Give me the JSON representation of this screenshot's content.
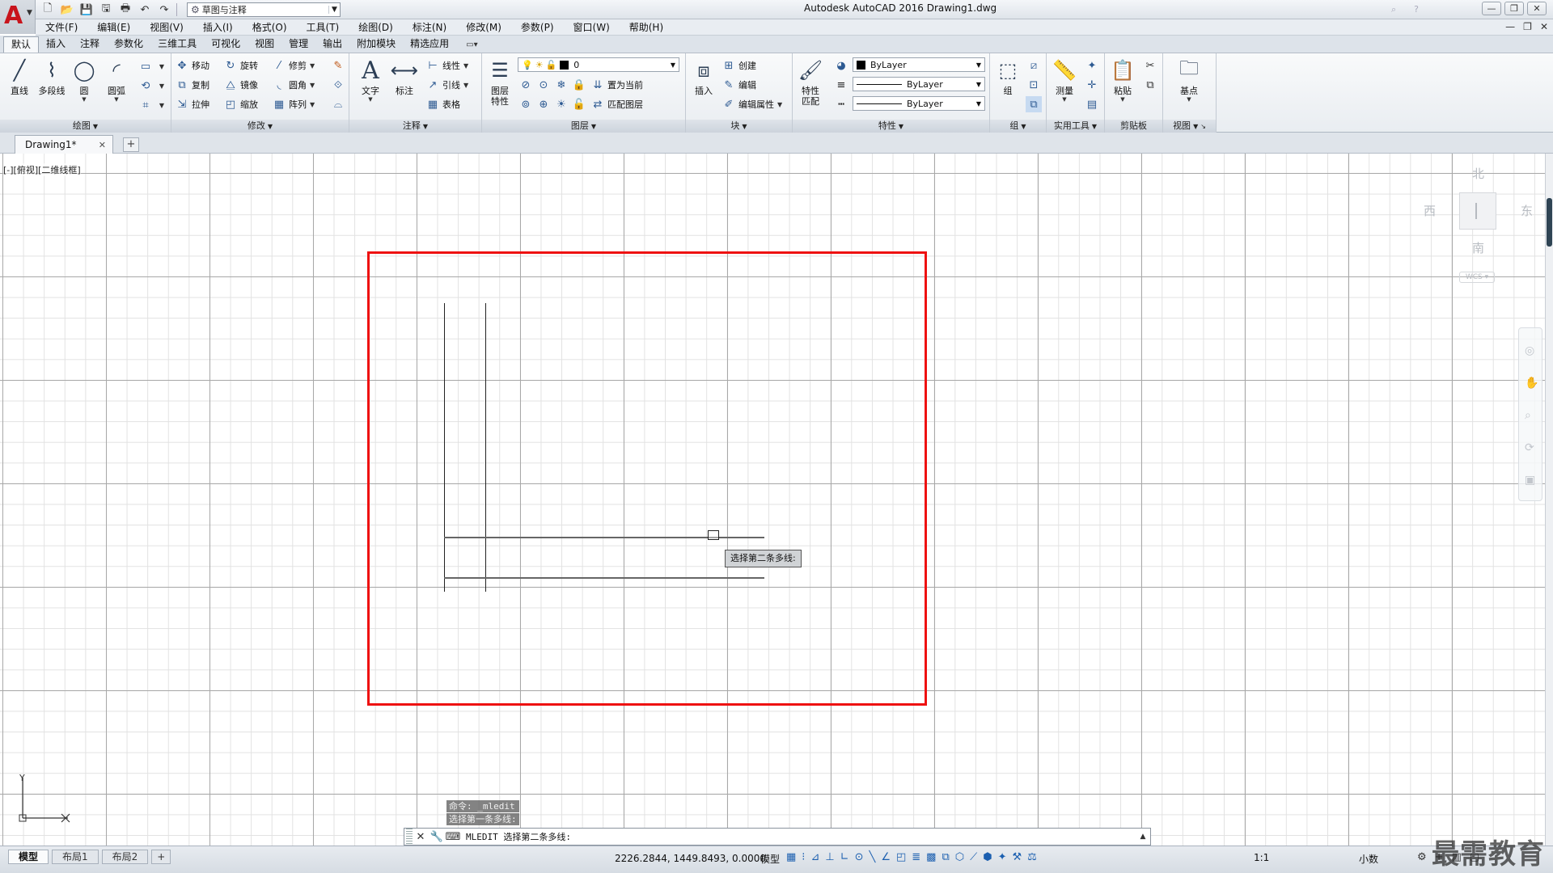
{
  "title_bar": {
    "title": "Autodesk AutoCAD 2016    Drawing1.dwg",
    "workspace": "草图与注释",
    "window_controls": [
      "—",
      "❐",
      "✕"
    ]
  },
  "menu": {
    "items": [
      "文件(F)",
      "编辑(E)",
      "视图(V)",
      "插入(I)",
      "格式(O)",
      "工具(T)",
      "绘图(D)",
      "标注(N)",
      "修改(M)",
      "参数(P)",
      "窗口(W)",
      "帮助(H)"
    ],
    "doc_controls": [
      "—",
      "❐",
      "✕"
    ]
  },
  "ribbon_tabs": {
    "items": [
      "默认",
      "插入",
      "注释",
      "参数化",
      "三维工具",
      "可视化",
      "视图",
      "管理",
      "输出",
      "附加模块",
      "精选应用"
    ],
    "active": "默认",
    "extra": "▭▾"
  },
  "ribbon": {
    "draw": {
      "title": "绘图",
      "line": "直线",
      "polyline": "多段线",
      "circle": "圆",
      "arc": "圆弧"
    },
    "modify": {
      "title": "修改",
      "move": "移动",
      "rotate": "旋转",
      "trim": "修剪",
      "copy": "复制",
      "mirror": "镜像",
      "fillet": "圆角",
      "stretch": "拉伸",
      "scale": "缩放",
      "array": "阵列"
    },
    "annotation": {
      "title": "注释",
      "text": "文字",
      "dimension": "标注",
      "linear": "线性",
      "leader": "引线",
      "table": "表格"
    },
    "layers": {
      "title": "图层",
      "layer_props": "图层\n特性",
      "current_layer": "0",
      "set_current": "置为当前",
      "match_layer": "匹配图层"
    },
    "block": {
      "title": "块",
      "insert": "插入",
      "create": "创建",
      "edit": "编辑",
      "edit_attr": "编辑属性"
    },
    "properties": {
      "title": "特性",
      "match": "特性\n匹配",
      "color": "ByLayer",
      "linetype": "ByLayer",
      "lineweight": "ByLayer"
    },
    "groups": {
      "title": "组",
      "group": "组"
    },
    "utilities": {
      "title": "实用工具",
      "measure": "测量"
    },
    "clipboard": {
      "title": "剪贴板",
      "paste": "粘贴"
    },
    "view": {
      "title": "视图",
      "base": "基点"
    }
  },
  "file_tabs": {
    "active": "Drawing1*"
  },
  "canvas": {
    "viewport_label": "[-][俯视][二维线框]",
    "tooltip": "选择第二条多线:",
    "viewcube": {
      "north": "北",
      "south": "南",
      "east": "东",
      "west": "西",
      "ucs": "WCS"
    },
    "ucs_y": "Y"
  },
  "command": {
    "history": [
      "命令: _mledit",
      "选择第一条多线:"
    ],
    "prompt": "MLEDIT 选择第二条多线:"
  },
  "status": {
    "layout_tabs": [
      "模型",
      "布局1",
      "布局2"
    ],
    "active_layout": "模型",
    "coordinates": "2226.2844, 1449.8493, 0.0000",
    "model": "模型",
    "scale": "1:1",
    "units": "小数"
  },
  "watermark": "最需教育",
  "colors": {
    "highlight_box": "#ee1111",
    "grid_major": "#a8a8a8",
    "grid_minor": "#e2e2e2",
    "logo": "#c8141c"
  }
}
